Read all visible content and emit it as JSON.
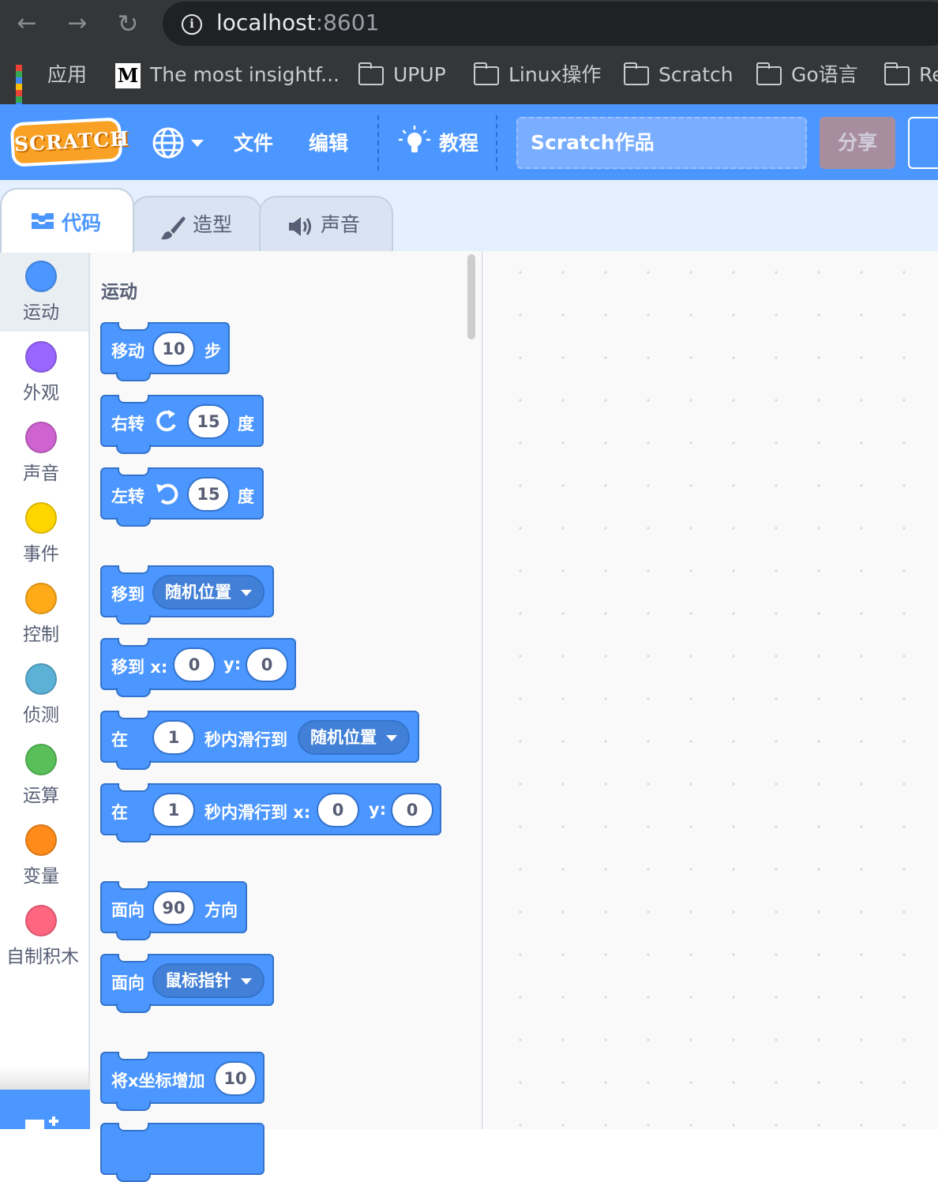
{
  "browser": {
    "url_host": "localhost",
    "url_port": ":8601",
    "bookmarks": [
      {
        "icon": "apps-grid-icon",
        "label": "应用"
      },
      {
        "icon": "medium-logo-icon",
        "label": "The most insightf..."
      },
      {
        "icon": "folder-icon",
        "label": "UPUP"
      },
      {
        "icon": "folder-icon",
        "label": "Linux操作"
      },
      {
        "icon": "folder-icon",
        "label": "Scratch"
      },
      {
        "icon": "folder-icon",
        "label": "Go语言"
      },
      {
        "icon": "folder-icon",
        "label": "Re"
      }
    ]
  },
  "menubar": {
    "logo": "SCRATCH",
    "file": "文件",
    "edit": "编辑",
    "tutorials": "教程",
    "project_title": "Scratch作品",
    "share": "分享"
  },
  "tabs": {
    "code": "代码",
    "costumes": "造型",
    "sounds": "声音"
  },
  "categories": [
    {
      "label": "运动",
      "color": "#4c97ff"
    },
    {
      "label": "外观",
      "color": "#9966ff"
    },
    {
      "label": "声音",
      "color": "#cf63cf"
    },
    {
      "label": "事件",
      "color": "#ffd500"
    },
    {
      "label": "控制",
      "color": "#ffab19"
    },
    {
      "label": "侦测",
      "color": "#5cb1d6"
    },
    {
      "label": "运算",
      "color": "#59c059"
    },
    {
      "label": "变量",
      "color": "#ff8c1a"
    },
    {
      "label": "自制积木",
      "color": "#ff6680"
    }
  ],
  "palette": {
    "section_title": "运动",
    "blocks": {
      "move": {
        "label": "移动",
        "value": "10",
        "suffix": "步"
      },
      "turn_right": {
        "label": "右转",
        "value": "15",
        "suffix": "度"
      },
      "turn_left": {
        "label": "左转",
        "value": "15",
        "suffix": "度"
      },
      "goto": {
        "label": "移到",
        "menu": "随机位置"
      },
      "goto_xy": {
        "label": "移到 x:",
        "x": "0",
        "ylabel": "y:",
        "y": "0"
      },
      "glide_to": {
        "label": "在",
        "secs": "1",
        "middle": "秒内滑行到",
        "menu": "随机位置"
      },
      "glide_xy": {
        "label": "在",
        "secs": "1",
        "middle": "秒内滑行到 x:",
        "x": "0",
        "ylabel": "y:",
        "y": "0"
      },
      "point_dir": {
        "label": "面向",
        "value": "90",
        "suffix": "方向"
      },
      "point_towards": {
        "label": "面向",
        "menu": "鼠标指针"
      },
      "change_x": {
        "label": "将x坐标增加",
        "value": "10"
      }
    }
  }
}
